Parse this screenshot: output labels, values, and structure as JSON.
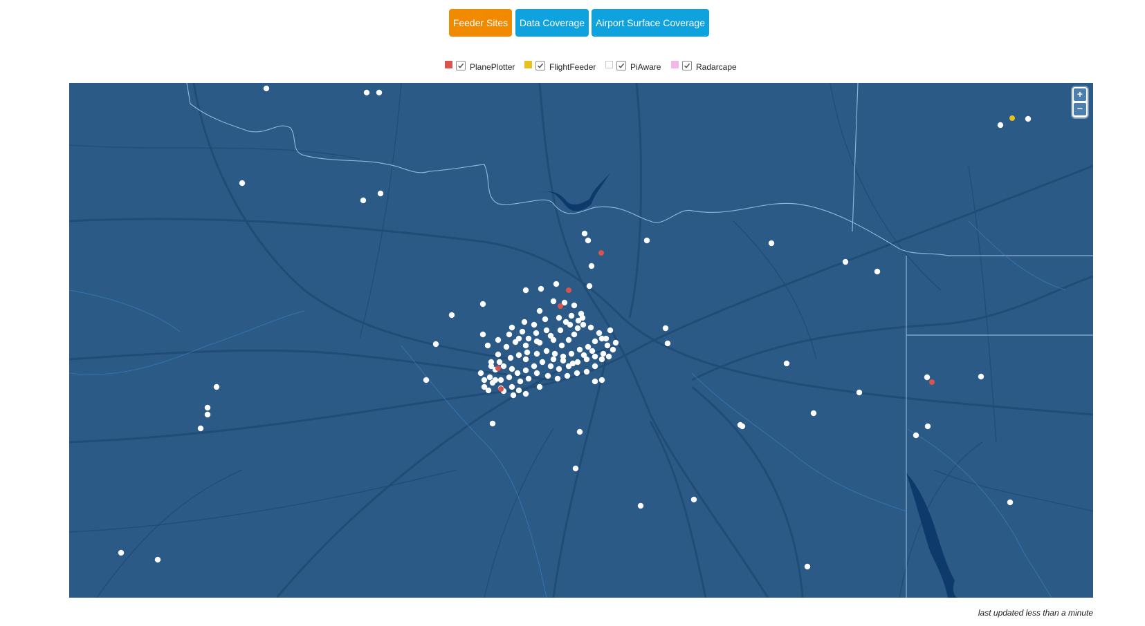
{
  "tabs": [
    {
      "label": "Feeder Sites",
      "active": true,
      "color": "#f28a00"
    },
    {
      "label": "Data Coverage",
      "active": false,
      "color": "#0ea3de"
    },
    {
      "label": "Airport Surface Coverage",
      "active": false,
      "color": "#0ea3de"
    }
  ],
  "legend": [
    {
      "label": "PlanePlotter",
      "color": "#d9534f",
      "checked": true
    },
    {
      "label": "FlightFeeder",
      "color": "#e8c21a",
      "checked": true
    },
    {
      "label": "PiAware",
      "color": "#ffffff",
      "checked": true
    },
    {
      "label": "Radarcape",
      "color": "#f3b8e6",
      "checked": true
    }
  ],
  "map": {
    "background_color": "#2b5a87",
    "river_color": "#9ec3e6",
    "water_color": "#0d3a6b",
    "zoom_in_label": "+",
    "zoom_out_label": "−"
  },
  "footer": {
    "last_updated": "last updated less than a minute"
  }
}
